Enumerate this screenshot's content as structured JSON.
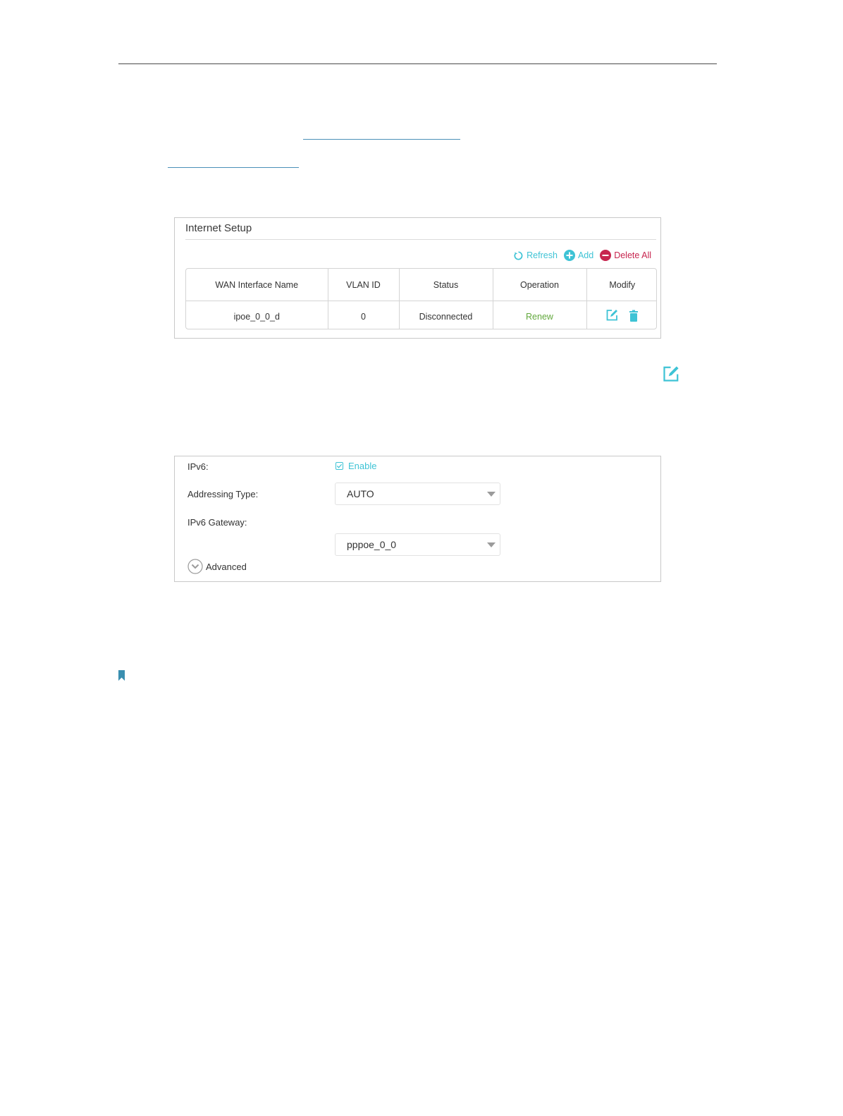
{
  "internet_setup": {
    "title": "Internet Setup",
    "toolbar": {
      "refresh_label": "Refresh",
      "add_label": "Add",
      "delete_all_label": "Delete All"
    },
    "columns": [
      "WAN Interface Name",
      "VLAN ID",
      "Status",
      "Operation",
      "Modify"
    ],
    "rows": [
      {
        "wan_interface_name": "ipoe_0_0_d",
        "vlan_id": "0",
        "status": "Disconnected",
        "operation": "Renew"
      }
    ]
  },
  "ipv6_form": {
    "ipv6_label": "IPv6:",
    "enable_label": "Enable",
    "enable_checked": true,
    "addressing_type_label": "Addressing Type:",
    "addressing_type_value": "AUTO",
    "gateway_label": "IPv6 Gateway:",
    "gateway_value": "pppoe_0_0",
    "advanced_label": "Advanced"
  },
  "colors": {
    "accent": "#3ec3d5",
    "danger": "#c7254e",
    "ok": "#62a83c",
    "note": "#3a8fb0"
  },
  "icons": [
    "refresh-icon",
    "add-icon",
    "delete-all-icon",
    "edit-icon",
    "trash-icon",
    "chevron-down-icon",
    "bookmark-icon"
  ]
}
